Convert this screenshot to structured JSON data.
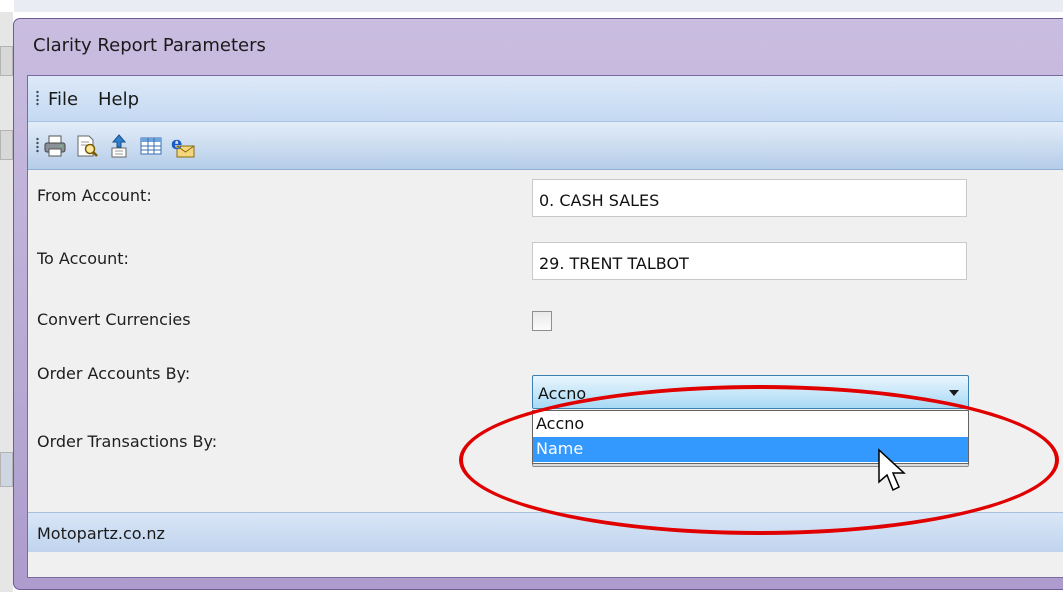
{
  "dialog": {
    "title": "Clarity Report Parameters"
  },
  "menu": {
    "items": [
      "File",
      "Help"
    ]
  },
  "toolbar": {
    "icons": [
      "print-icon",
      "print-preview-icon",
      "export-icon",
      "table-view-icon",
      "email-icon"
    ]
  },
  "params": {
    "from_account": {
      "label": "From Account:",
      "value": "0. CASH SALES"
    },
    "to_account": {
      "label": "To Account:",
      "value": "29. TRENT TALBOT"
    },
    "convert_currencies": {
      "label": "Convert Currencies",
      "checked": false
    },
    "order_accounts_by": {
      "label": "Order Accounts By:",
      "selected": "Accno",
      "options": [
        "Accno",
        "Name"
      ],
      "highlighted": "Name"
    },
    "order_transactions_by": {
      "label": "Order Transactions By:"
    }
  },
  "status": {
    "text": "Motopartz.co.nz"
  },
  "colors": {
    "annotation_ring": "#e00000",
    "selection": "#3399ff",
    "title_bar": "#b9aad5"
  }
}
